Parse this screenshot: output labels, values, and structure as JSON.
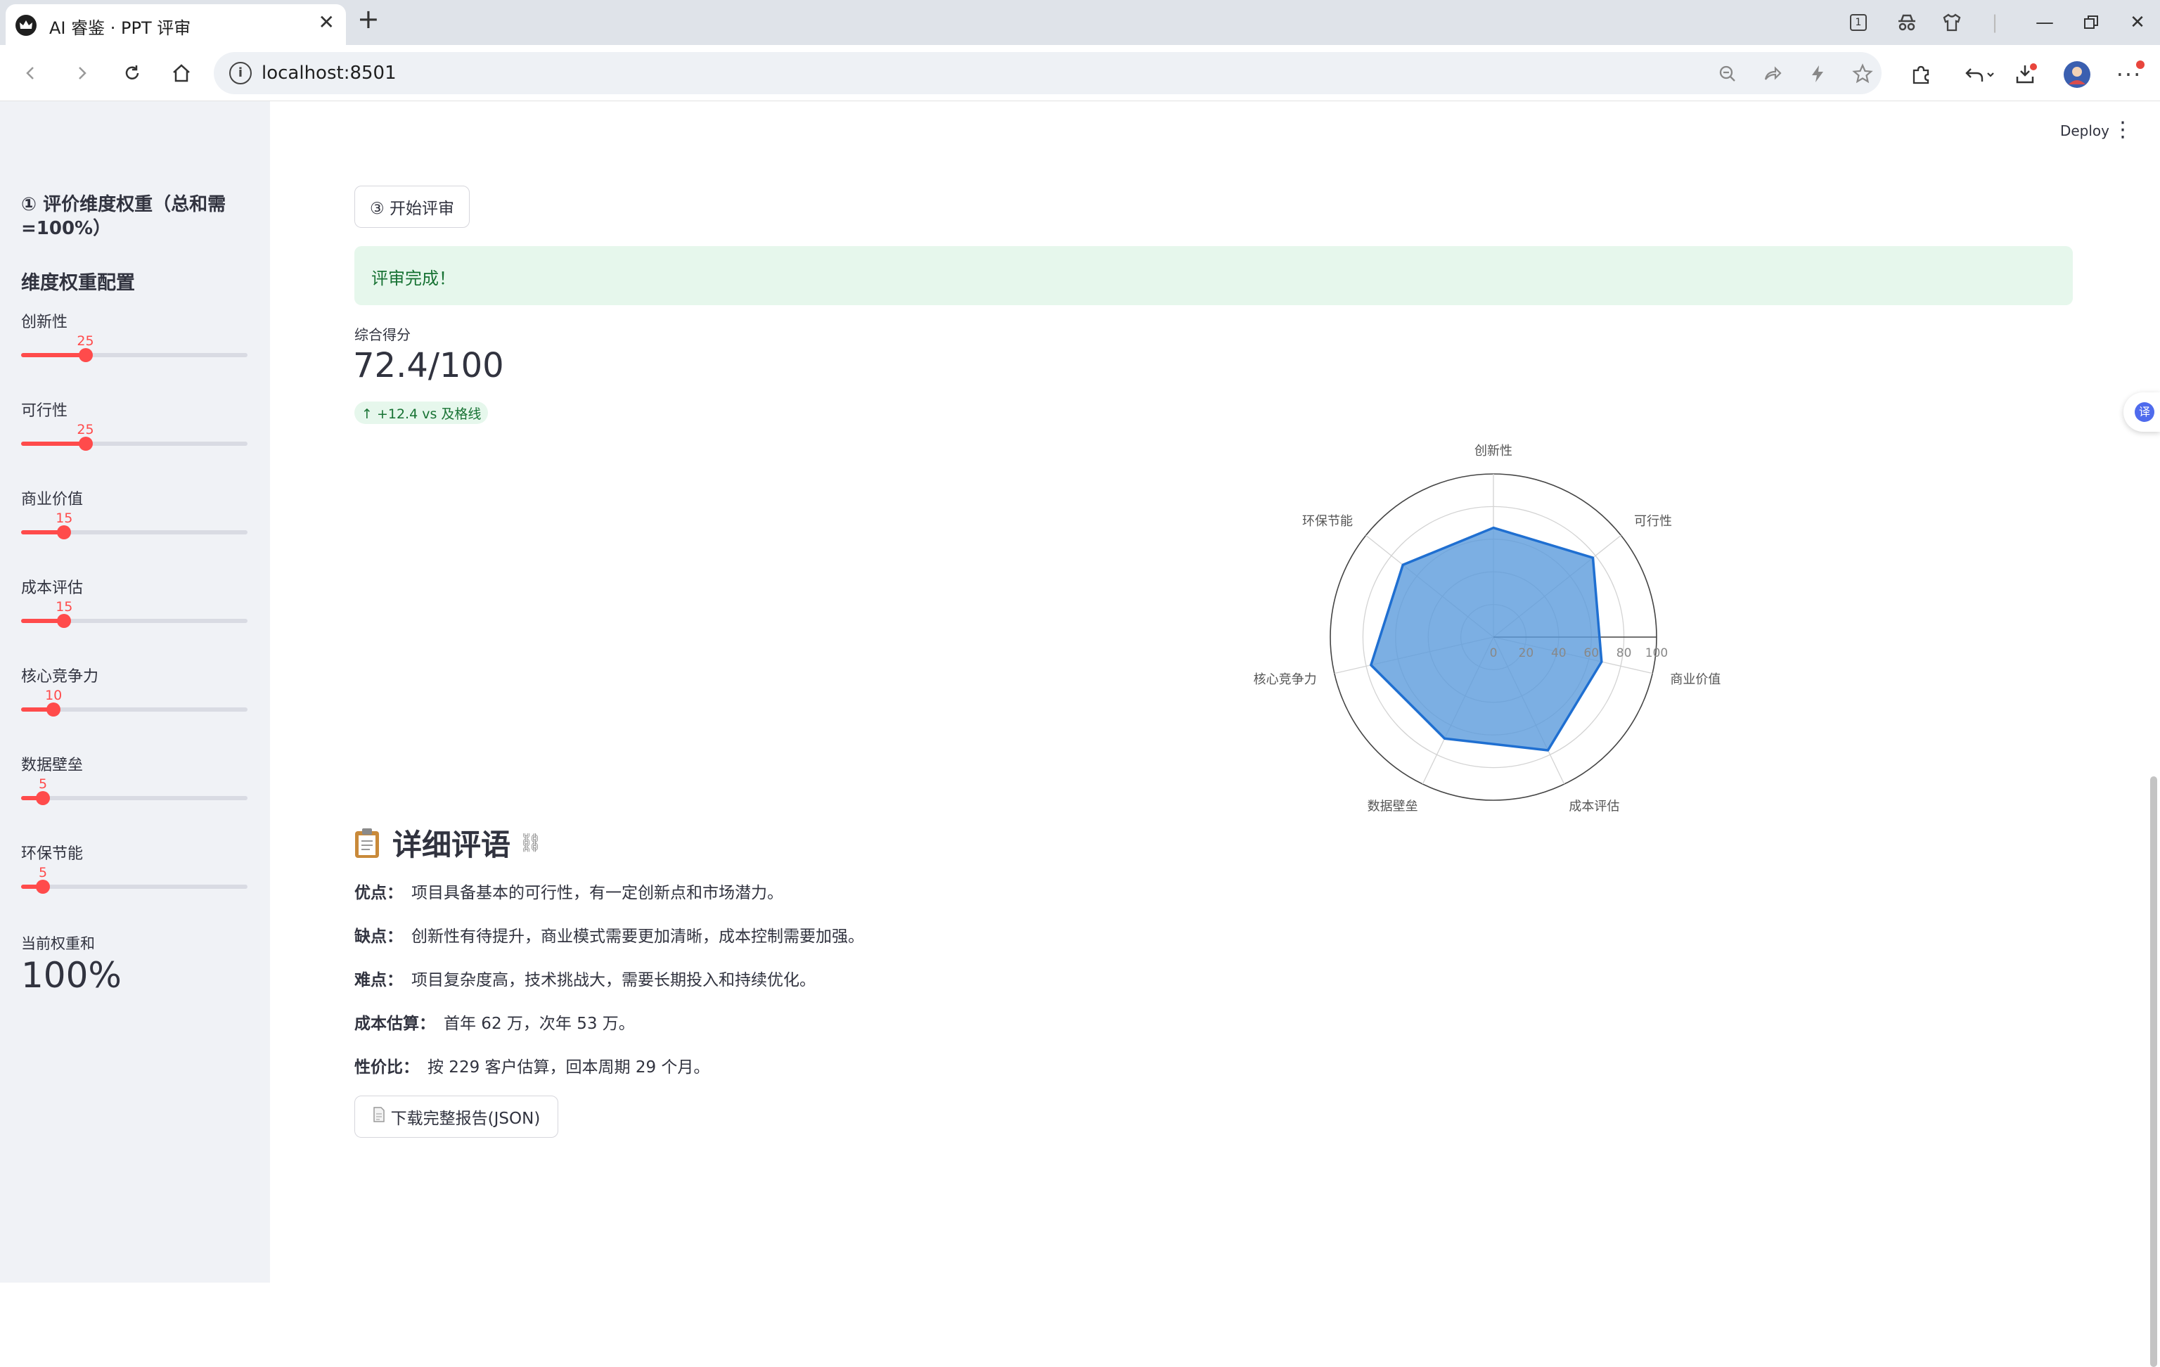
{
  "browser": {
    "tab_title": "AI 睿鉴 · PPT 评审",
    "url": "localhost:8501",
    "badge_count": "1"
  },
  "app": {
    "deploy_label": "Deploy",
    "sidebar": {
      "title": "① 评价维度权重（总和需=100%）",
      "subtitle": "维度权重配置",
      "slider_max": 100,
      "sliders": [
        {
          "label": "创新性",
          "value": 25
        },
        {
          "label": "可行性",
          "value": 25
        },
        {
          "label": "商业价值",
          "value": 15
        },
        {
          "label": "成本评估",
          "value": 15
        },
        {
          "label": "核心竞争力",
          "value": 10
        },
        {
          "label": "数据壁垒",
          "value": 5
        },
        {
          "label": "环保节能",
          "value": 5
        }
      ],
      "weight_sum_label": "当前权重和",
      "weight_sum_value": "100%"
    },
    "start_button": "③ 开始评审",
    "success_message": "评审完成！",
    "score": {
      "label": "综合得分",
      "value": "72.4/100",
      "delta": "↑ +12.4 vs 及格线"
    },
    "details": {
      "title": "详细评语",
      "items": [
        {
          "label": "优点：",
          "text": "项目具备基本的可行性，有一定创新点和市场潜力。"
        },
        {
          "label": "缺点：",
          "text": "创新性有待提升，商业模式需要更加清晰，成本控制需要加强。"
        },
        {
          "label": "难点：",
          "text": "项目复杂度高，技术挑战大，需要长期投入和持续优化。"
        },
        {
          "label": "成本估算：",
          "text": "首年 62 万，次年 53 万。"
        },
        {
          "label": "性价比：",
          "text": "按 229 客户估算，回本周期 29 个月。"
        }
      ],
      "download_button": "下载完整报告(JSON)"
    }
  },
  "chart_data": {
    "type": "radar",
    "categories": [
      "创新性",
      "可行性",
      "商业价值",
      "成本评估",
      "数据壁垒",
      "核心竞争力",
      "环保节能"
    ],
    "values": [
      67,
      78,
      68,
      77,
      69,
      77,
      71
    ],
    "radial_range": [
      0,
      100
    ],
    "radial_ticks": [
      0,
      20,
      40,
      60,
      80,
      100
    ],
    "fill_color": "#5b9bdc",
    "line_color": "#1f6fd1"
  },
  "colors": {
    "accent": "#ff4b4b",
    "success_bg": "#e6f7ec",
    "success_text": "#177233",
    "sidebar_bg": "#f0f2f6"
  }
}
